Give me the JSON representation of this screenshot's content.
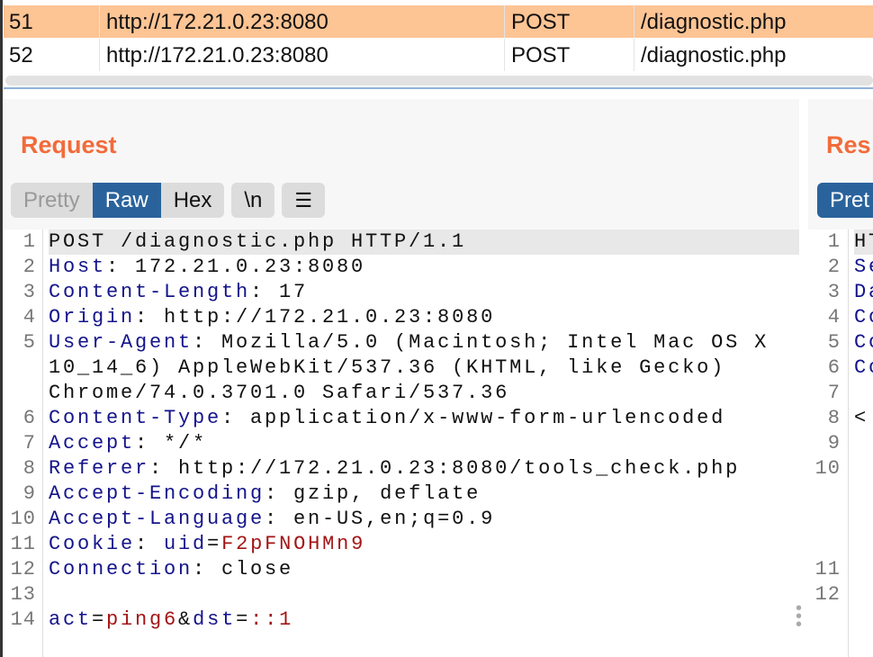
{
  "history": {
    "rows": [
      {
        "num": "51",
        "host": "http://172.21.0.23:8080",
        "method": "POST",
        "url": "/diagnostic.php",
        "selected": true
      },
      {
        "num": "52",
        "host": "http://172.21.0.23:8080",
        "method": "POST",
        "url": "/diagnostic.php",
        "selected": false
      }
    ]
  },
  "request": {
    "title": "Request",
    "tabs": {
      "pretty": "Pretty",
      "raw": "Raw",
      "hex": "Hex",
      "newline": "\\n"
    },
    "lines": [
      {
        "n": "1",
        "key": "POST /diagnostic.php HTTP/1.1",
        "val": ""
      },
      {
        "n": "2",
        "key": "Host",
        "val": ": 172.21.0.23:8080"
      },
      {
        "n": "3",
        "key": "Content-Length",
        "val": ": 17"
      },
      {
        "n": "4",
        "key": "Origin",
        "val": ": http://172.21.0.23:8080"
      },
      {
        "n": "5",
        "key": "User-Agent",
        "val": ": Mozilla/5.0 (Macintosh; Intel Mac OS X",
        "cont": [
          "10_14_6) AppleWebKit/537.36 (KHTML, like Gecko)",
          "Chrome/74.0.3701.0 Safari/537.36"
        ]
      },
      {
        "n": "6",
        "key": "Content-Type",
        "val": ": application/x-www-form-urlencoded"
      },
      {
        "n": "7",
        "key": "Accept",
        "val": ": */*"
      },
      {
        "n": "8",
        "key": "Referer",
        "val": ": http://172.21.0.23:8080/tools_check.php"
      },
      {
        "n": "9",
        "key": "Accept-Encoding",
        "val": ": gzip, deflate"
      },
      {
        "n": "10",
        "key": "Accept-Language",
        "val": ": en-US,en;q=0.9"
      },
      {
        "n": "11",
        "key": "Cookie",
        "val": ": ",
        "ck": "uid",
        "eq": "=",
        "cv": "F2pFNOHMn9"
      },
      {
        "n": "12",
        "key": "Connection",
        "val": ": close"
      },
      {
        "n": "13",
        "key": "",
        "val": ""
      },
      {
        "n": "14",
        "body": {
          "p1": "act",
          "e1": "=",
          "v1": "ping6",
          "amp": "&",
          "p2": "dst",
          "e2": "=",
          "v2": "::1"
        }
      }
    ]
  },
  "response": {
    "title": "Res",
    "tab": "Pret",
    "lines": [
      {
        "n": "1",
        "t": "HT"
      },
      {
        "n": "2",
        "t": "Se"
      },
      {
        "n": "3",
        "t": "Da"
      },
      {
        "n": "4",
        "t": "Co"
      },
      {
        "n": "5",
        "t": "Co"
      },
      {
        "n": "6",
        "t": "Co"
      },
      {
        "n": "7",
        "t": ""
      },
      {
        "n": "8",
        "t": "<"
      },
      {
        "n": "9",
        "t": ""
      },
      {
        "n": "10",
        "t": ""
      },
      {
        "n": "11",
        "t": ""
      },
      {
        "n": "12",
        "t": ""
      }
    ]
  }
}
